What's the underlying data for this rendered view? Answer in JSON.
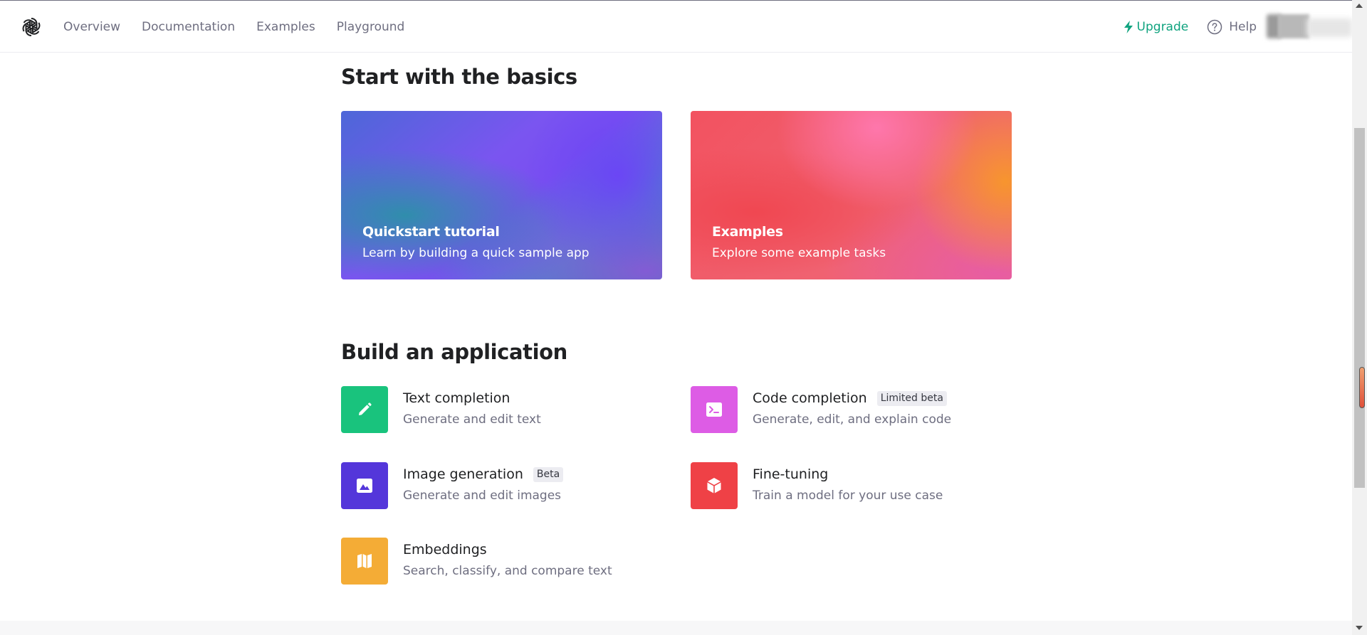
{
  "header": {
    "logo_icon": "openai-logo-icon",
    "nav": [
      "Overview",
      "Documentation",
      "Examples",
      "Playground"
    ],
    "upgrade_label": "Upgrade",
    "upgrade_icon": "lightning-bolt-icon",
    "help_label": "Help",
    "help_icon": "question-circle-icon",
    "accent_color": "#10a37f"
  },
  "basics": {
    "title": "Start with the basics",
    "cards": [
      {
        "title": "Quickstart tutorial",
        "description": "Learn by building a quick sample app"
      },
      {
        "title": "Examples",
        "description": "Explore some example tasks"
      }
    ]
  },
  "build": {
    "title": "Build an application",
    "apps": [
      {
        "name": "Text completion",
        "description": "Generate and edit text",
        "badge": "",
        "icon": "pencil-icon",
        "color": "#19c37d"
      },
      {
        "name": "Code completion",
        "description": "Generate, edit, and explain code",
        "badge": "Limited beta",
        "icon": "terminal-icon",
        "color": "#dd5ce5"
      },
      {
        "name": "Image generation",
        "description": "Generate and edit images",
        "badge": "Beta",
        "icon": "image-icon",
        "color": "#5436da"
      },
      {
        "name": "Fine-tuning",
        "description": "Train a model for your use case",
        "badge": "",
        "icon": "cube-icon",
        "color": "#ef4146"
      },
      {
        "name": "Embeddings",
        "description": "Search, classify, and compare text",
        "badge": "",
        "icon": "map-icon",
        "color": "#f4ac36"
      }
    ]
  }
}
